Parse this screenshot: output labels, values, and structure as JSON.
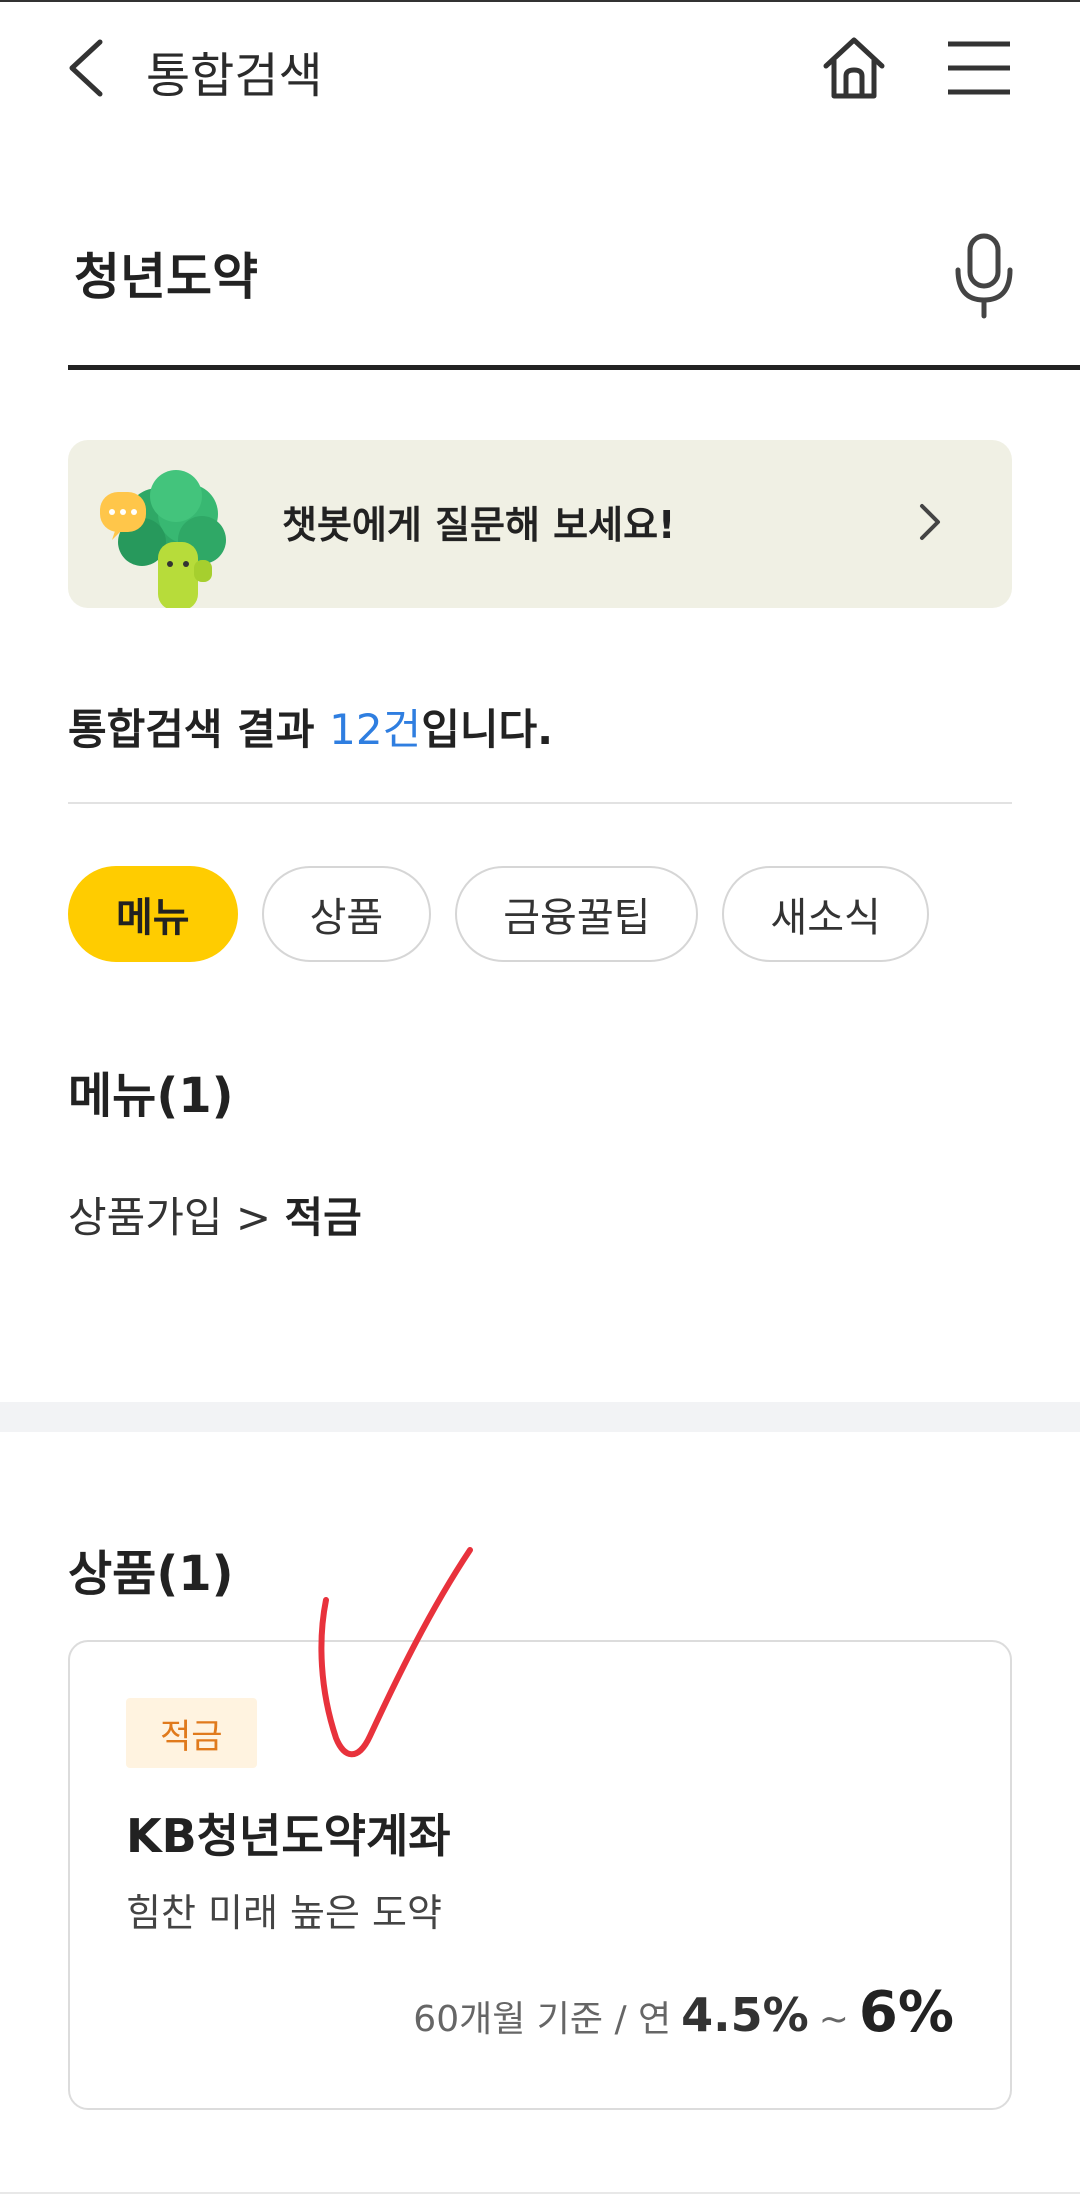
{
  "header": {
    "title": "통합검색"
  },
  "search": {
    "value": "청년도약",
    "placeholder": ""
  },
  "chatbot": {
    "label": "챗봇에게 질문해 보세요!"
  },
  "result": {
    "prefix": "통합검색 결과 ",
    "count": "12건",
    "suffix": "입니다."
  },
  "tabs": [
    {
      "label": "메뉴",
      "active": true
    },
    {
      "label": "상품",
      "active": false
    },
    {
      "label": "금융꿀팁",
      "active": false
    },
    {
      "label": "새소식",
      "active": false
    }
  ],
  "menu_section": {
    "title": "메뉴(1)",
    "path_parent": "상품가입 > ",
    "path_leaf": "적금"
  },
  "product_section": {
    "title": "상품(1)",
    "card": {
      "category": "적금",
      "name": "KB청년도약계좌",
      "description": "힘찬 미래 높은 도약",
      "rate_basis": "60개월 기준 / 연",
      "rate_min": "4.5%",
      "rate_tilde": "~",
      "rate_max": "6%"
    }
  },
  "colors": {
    "accent_yellow": "#ffcc00",
    "count_blue": "#2f7ee0",
    "badge_orange": "#e07a1c",
    "banner_bg": "#f0f0e4",
    "check_red": "#e8323c"
  },
  "icons": [
    "back-icon",
    "home-icon",
    "hamburger-menu-icon",
    "microphone-icon",
    "chatbot-mascot-icon",
    "chevron-right-icon"
  ]
}
